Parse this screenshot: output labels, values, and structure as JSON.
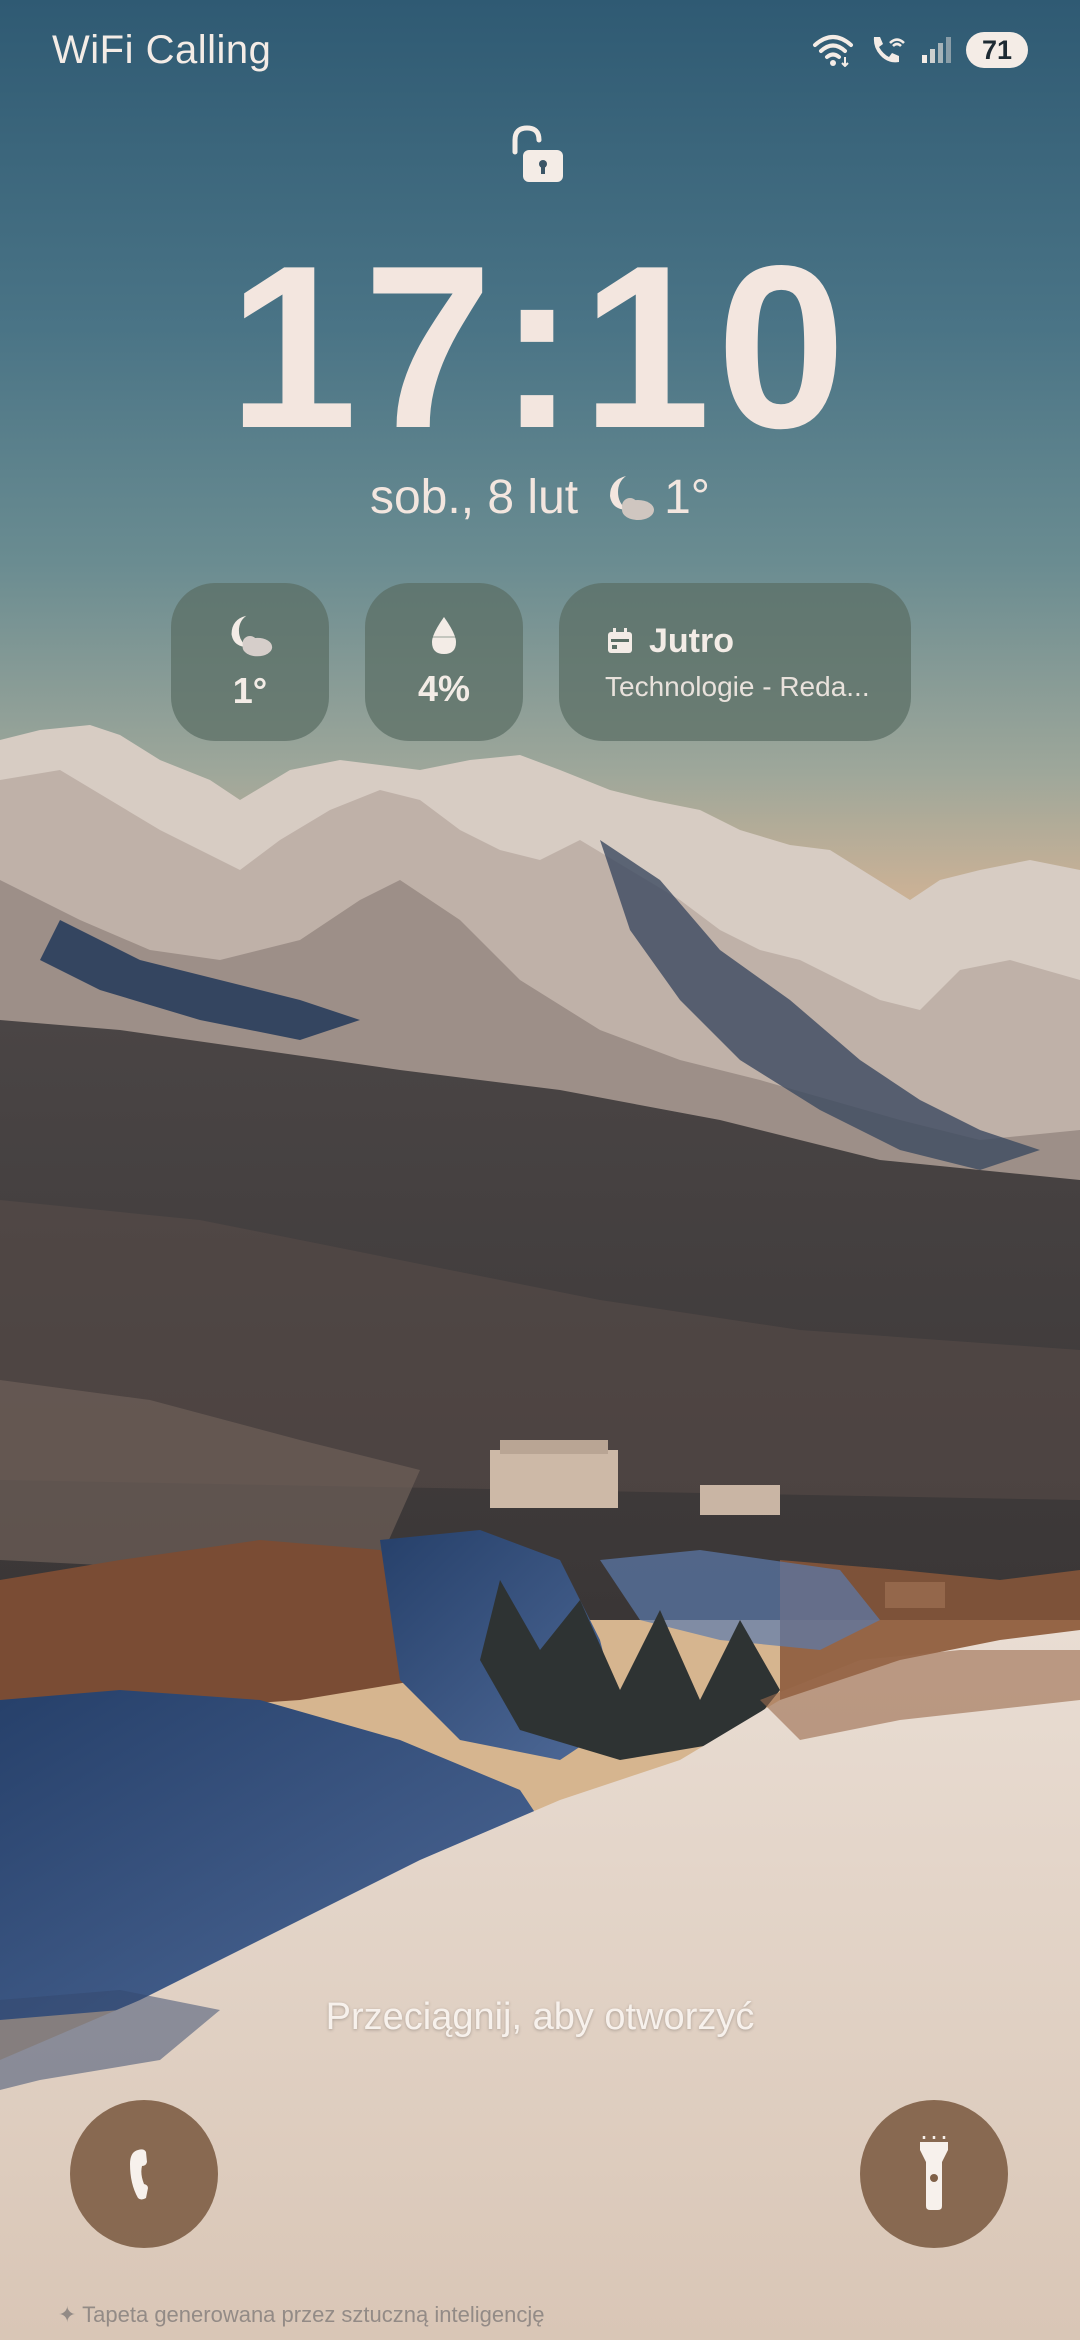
{
  "status_bar": {
    "carrier": "WiFi Calling",
    "battery": "71",
    "icons": [
      "wifi-icon",
      "wifi-call-icon",
      "signal-icon",
      "battery-icon"
    ]
  },
  "lock_screen": {
    "lock_icon": "unlocked-padlock-icon",
    "time": "17:10",
    "date": "sob., 8 lut",
    "weather_temp": "1°",
    "weather_icon": "moon-cloud-icon"
  },
  "widgets": {
    "weather": {
      "icon": "moon-cloud-icon",
      "value": "1°"
    },
    "precipitation": {
      "icon": "water-drop-icon",
      "value": "4%"
    },
    "calendar": {
      "icon": "calendar-icon",
      "title": "Jutro",
      "event": "Technologie - Reda..."
    }
  },
  "swipe_hint": "Przeciągnij, aby otworzyć",
  "shortcuts": {
    "left": "phone-icon",
    "right": "flashlight-icon"
  },
  "ai_note": "✦ Tapeta generowana przez sztuczną inteligencję",
  "colors": {
    "text": "#f3e6df",
    "widget_bg": "#5a6e64",
    "shortcut_bg": "#806148"
  }
}
